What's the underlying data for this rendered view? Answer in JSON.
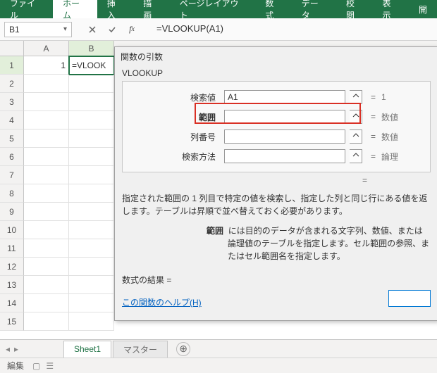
{
  "ribbon": {
    "tabs": [
      "ファイル",
      "ホーム",
      "挿入",
      "描画",
      "ページレイアウト",
      "数式",
      "データ",
      "校閲",
      "表示",
      "開"
    ]
  },
  "namebox": {
    "value": "B1"
  },
  "formula_bar": {
    "formula": "=VLOOKUP(A1)"
  },
  "grid": {
    "columns": [
      "A",
      "B"
    ],
    "row_count": 15,
    "cells": {
      "A1": "1",
      "B1": "=VLOOK"
    },
    "active_cell": "B1"
  },
  "dialog": {
    "title": "関数の引数",
    "func": "VLOOKUP",
    "args": [
      {
        "label": "検索値",
        "value": "A1",
        "result": "1"
      },
      {
        "label": "範囲",
        "value": "",
        "result": "数値",
        "highlight": true
      },
      {
        "label": "列番号",
        "value": "",
        "result": "数値"
      },
      {
        "label": "検索方法",
        "value": "",
        "result": "論理"
      }
    ],
    "overall_eq": "=",
    "description": "指定された範囲の 1 列目で特定の値を検索し、指定した列と同じ行にある値を返します。テーブルは昇順で並べ替えておく必要があります。",
    "arg_help_label": "範囲",
    "arg_help": "には目的のデータが含まれる文字列、数値、または論理値のテーブルを指定します。セル範囲の参照、またはセル範囲名を指定します。",
    "result_label": "数式の結果 =",
    "help_link": "この関数のヘルプ(H)"
  },
  "sheet_tabs": {
    "active": "Sheet1",
    "others": [
      "マスター"
    ]
  },
  "status": {
    "mode": "編集"
  }
}
